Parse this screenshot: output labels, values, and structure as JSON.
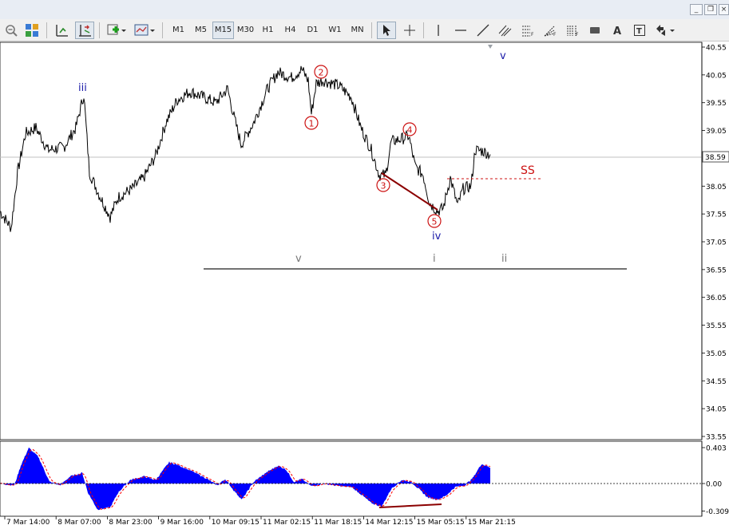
{
  "timeframes": [
    "M1",
    "M5",
    "M15",
    "M30",
    "H1",
    "H4",
    "D1",
    "W1",
    "MN"
  ],
  "active_timeframe": "M15",
  "window_buttons": [
    "minimize",
    "restore",
    "close"
  ],
  "colors": {
    "price": "#000000",
    "wave_red": "#cc1111",
    "wave_blue": "#1a1aa8",
    "wave_grey": "#777777",
    "histogram": "#0000ff",
    "signal": "#ff0000",
    "divergence": "#8b0000",
    "current_line": "#c0c0c0"
  },
  "chart_data": {
    "type": "line",
    "price_axis": [
      "40.55",
      "40.05",
      "39.55",
      "39.05",
      "38.59",
      "38.05",
      "37.55",
      "37.05",
      "36.55",
      "36.05",
      "35.55",
      "35.05",
      "34.55",
      "34.05",
      "33.55"
    ],
    "current_price": "38.59",
    "time_axis": [
      "7 Mar 14:00",
      "8 Mar 07:00",
      "8 Mar 23:00",
      "9 Mar 16:00",
      "10 Mar 09:15",
      "11 Mar 02:15",
      "11 Mar 18:15",
      "14 Mar 12:15",
      "15 Mar 05:15",
      "15 Mar 21:15"
    ],
    "osc_axis": [
      "0.403",
      "0.00",
      "-0.309"
    ],
    "price": [
      [
        0,
        37.6
      ],
      [
        14,
        37.3
      ],
      [
        22,
        38.3
      ],
      [
        32,
        39.0
      ],
      [
        45,
        39.1
      ],
      [
        60,
        38.7
      ],
      [
        80,
        38.75
      ],
      [
        95,
        39.1
      ],
      [
        105,
        39.7
      ],
      [
        112,
        38.3
      ],
      [
        124,
        37.9
      ],
      [
        138,
        37.5
      ],
      [
        148,
        37.85
      ],
      [
        165,
        38.0
      ],
      [
        180,
        38.2
      ],
      [
        195,
        38.6
      ],
      [
        208,
        39.2
      ],
      [
        222,
        39.6
      ],
      [
        238,
        39.75
      ],
      [
        255,
        39.65
      ],
      [
        270,
        39.55
      ],
      [
        285,
        39.8
      ],
      [
        293,
        39.3
      ],
      [
        302,
        38.8
      ],
      [
        318,
        39.2
      ],
      [
        335,
        39.8
      ],
      [
        348,
        40.1
      ],
      [
        365,
        40.0
      ],
      [
        378,
        40.15
      ],
      [
        386,
        39.95
      ],
      [
        390,
        39.35
      ],
      [
        396,
        39.9
      ],
      [
        405,
        39.95
      ],
      [
        425,
        39.85
      ],
      [
        440,
        39.65
      ],
      [
        452,
        39.1
      ],
      [
        465,
        38.7
      ],
      [
        475,
        38.25
      ],
      [
        483,
        38.25
      ],
      [
        490,
        38.85
      ],
      [
        503,
        38.9
      ],
      [
        512,
        38.95
      ],
      [
        520,
        38.4
      ],
      [
        530,
        38.25
      ],
      [
        538,
        37.75
      ],
      [
        548,
        37.6
      ],
      [
        555,
        37.65
      ],
      [
        564,
        38.2
      ],
      [
        573,
        37.7
      ],
      [
        580,
        38.0
      ],
      [
        590,
        38.05
      ],
      [
        595,
        38.7
      ],
      [
        605,
        38.68
      ],
      [
        614,
        38.62
      ]
    ],
    "osc": [
      [
        0,
        0.0
      ],
      [
        18,
        -0.02
      ],
      [
        26,
        0.2
      ],
      [
        36,
        0.4
      ],
      [
        48,
        0.3
      ],
      [
        62,
        0.02
      ],
      [
        75,
        -0.02
      ],
      [
        88,
        0.08
      ],
      [
        103,
        0.12
      ],
      [
        110,
        -0.1
      ],
      [
        122,
        -0.29
      ],
      [
        138,
        -0.27
      ],
      [
        148,
        -0.1
      ],
      [
        163,
        0.04
      ],
      [
        180,
        0.08
      ],
      [
        195,
        0.04
      ],
      [
        212,
        0.24
      ],
      [
        225,
        0.2
      ],
      [
        240,
        0.14
      ],
      [
        258,
        0.06
      ],
      [
        272,
        -0.02
      ],
      [
        282,
        0.05
      ],
      [
        293,
        -0.08
      ],
      [
        303,
        -0.18
      ],
      [
        318,
        0.02
      ],
      [
        333,
        0.12
      ],
      [
        348,
        0.2
      ],
      [
        358,
        0.16
      ],
      [
        368,
        0.02
      ],
      [
        378,
        0.05
      ],
      [
        390,
        -0.03
      ],
      [
        405,
        0.0
      ],
      [
        425,
        -0.03
      ],
      [
        440,
        -0.04
      ],
      [
        452,
        -0.12
      ],
      [
        465,
        -0.22
      ],
      [
        478,
        -0.26
      ],
      [
        490,
        -0.06
      ],
      [
        503,
        0.04
      ],
      [
        515,
        0.02
      ],
      [
        522,
        -0.04
      ],
      [
        536,
        -0.16
      ],
      [
        548,
        -0.18
      ],
      [
        558,
        -0.14
      ],
      [
        570,
        -0.04
      ],
      [
        582,
        -0.02
      ],
      [
        592,
        0.06
      ],
      [
        603,
        0.22
      ],
      [
        614,
        0.18
      ]
    ],
    "wave_labels": [
      {
        "t": "iii",
        "color": "blue"
      },
      {
        "t": "v",
        "color": "blue"
      },
      {
        "t": "iv",
        "color": "blue"
      },
      {
        "t": "v",
        "color": "grey"
      },
      {
        "t": "i",
        "color": "grey"
      },
      {
        "t": "ii",
        "color": "grey"
      },
      {
        "t": "SS",
        "color": "red"
      }
    ],
    "circled_labels": [
      "1",
      "2",
      "3",
      "4",
      "5"
    ],
    "levels": {
      "horizontal_line": 36.6,
      "ss_level": 38.15
    }
  }
}
